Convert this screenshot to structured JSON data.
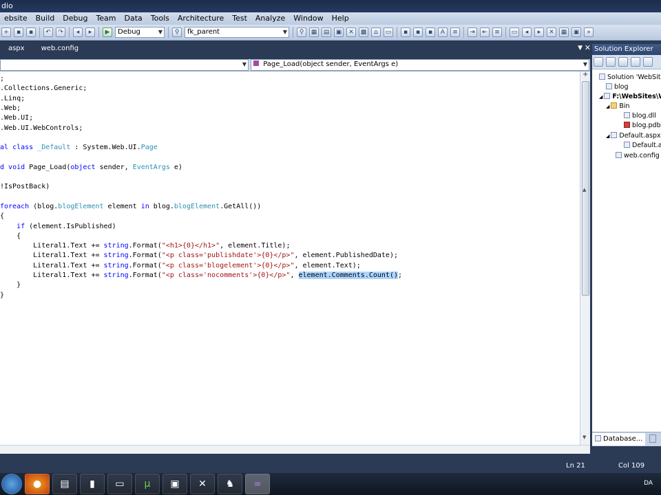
{
  "window": {
    "title_fragment": "dio"
  },
  "menu": [
    "ebsite",
    "Build",
    "Debug",
    "Team",
    "Data",
    "Tools",
    "Architecture",
    "Test",
    "Analyze",
    "Window",
    "Help"
  ],
  "toolbar": {
    "config": "Debug",
    "connection": "fk_parent"
  },
  "tabs": [
    "aspx",
    "web.config"
  ],
  "nav": {
    "member": "Page_Load(object sender, EventArgs e)"
  },
  "code": [
    [
      {
        "t": ";"
      }
    ],
    [
      {
        "t": ".Collections.Generic;"
      }
    ],
    [
      {
        "t": ".Linq;"
      }
    ],
    [
      {
        "t": ".Web;"
      }
    ],
    [
      {
        "t": ".Web.UI;"
      }
    ],
    [
      {
        "t": ".Web.UI.WebControls;"
      }
    ],
    [
      {
        "t": ""
      }
    ],
    [
      {
        "t": "al ",
        "c": "kw"
      },
      {
        "t": "class ",
        "c": "kw"
      },
      {
        "t": "_Default",
        "c": "ty"
      },
      {
        "t": " : System.Web.UI."
      },
      {
        "t": "Page",
        "c": "ty"
      }
    ],
    [
      {
        "t": ""
      }
    ],
    [
      {
        "t": "d ",
        "c": "kw"
      },
      {
        "t": "void ",
        "c": "kw"
      },
      {
        "t": "Page_Load("
      },
      {
        "t": "object ",
        "c": "kw"
      },
      {
        "t": "sender, "
      },
      {
        "t": "EventArgs",
        "c": "ty"
      },
      {
        "t": " e)"
      }
    ],
    [
      {
        "t": ""
      }
    ],
    [
      {
        "t": "!IsPostBack)"
      }
    ],
    [
      {
        "t": ""
      }
    ],
    [
      {
        "t": "foreach ",
        "c": "kw"
      },
      {
        "t": "(blog."
      },
      {
        "t": "blogElement",
        "c": "ty"
      },
      {
        "t": " element "
      },
      {
        "t": "in ",
        "c": "kw"
      },
      {
        "t": "blog."
      },
      {
        "t": "blogElement",
        "c": "ty"
      },
      {
        "t": ".GetAll())"
      }
    ],
    [
      {
        "t": "{"
      }
    ],
    [
      {
        "t": "    "
      },
      {
        "t": "if ",
        "c": "kw"
      },
      {
        "t": "(element.IsPublished)"
      }
    ],
    [
      {
        "t": "    {"
      }
    ],
    [
      {
        "t": "        Literal1.Text += "
      },
      {
        "t": "string",
        "c": "kw"
      },
      {
        "t": ".Format("
      },
      {
        "t": "\"<h1>{0}</h1>\"",
        "c": "st"
      },
      {
        "t": ", element.Title);"
      }
    ],
    [
      {
        "t": "        Literal1.Text += "
      },
      {
        "t": "string",
        "c": "kw"
      },
      {
        "t": ".Format("
      },
      {
        "t": "\"<p class='publishdate'>{0}</p>\"",
        "c": "st"
      },
      {
        "t": ", element.PublishedDate);"
      }
    ],
    [
      {
        "t": "        Literal1.Text += "
      },
      {
        "t": "string",
        "c": "kw"
      },
      {
        "t": ".Format("
      },
      {
        "t": "\"<p class='blogelement'>{0}</p>\"",
        "c": "st"
      },
      {
        "t": ", element.Text);"
      }
    ],
    [
      {
        "t": "        Literal1.Text += "
      },
      {
        "t": "string",
        "c": "kw"
      },
      {
        "t": ".Format("
      },
      {
        "t": "\"<p class='nocomments'>{0}</p>\"",
        "c": "st"
      },
      {
        "t": ", "
      },
      {
        "t": "element.Comments.Count()",
        "c": "sel"
      },
      {
        "t": ";"
      }
    ],
    [
      {
        "t": "    }"
      }
    ],
    [
      {
        "t": "}"
      }
    ]
  ],
  "solution_explorer": {
    "title": "Solution Explorer",
    "items": [
      {
        "label": "Solution 'WebSites"
      },
      {
        "label": "blog"
      },
      {
        "label": "F:\\WebSites\\W"
      },
      {
        "label": "Bin"
      },
      {
        "label": "blog.dll"
      },
      {
        "label": "blog.pdb"
      },
      {
        "label": "Default.aspx"
      },
      {
        "label": "Default.a"
      },
      {
        "label": "web.config"
      }
    ],
    "bottom_tab": "Database..."
  },
  "status": {
    "line": "Ln 21",
    "col": "Col 109"
  },
  "taskbar": {
    "language": "DA"
  }
}
